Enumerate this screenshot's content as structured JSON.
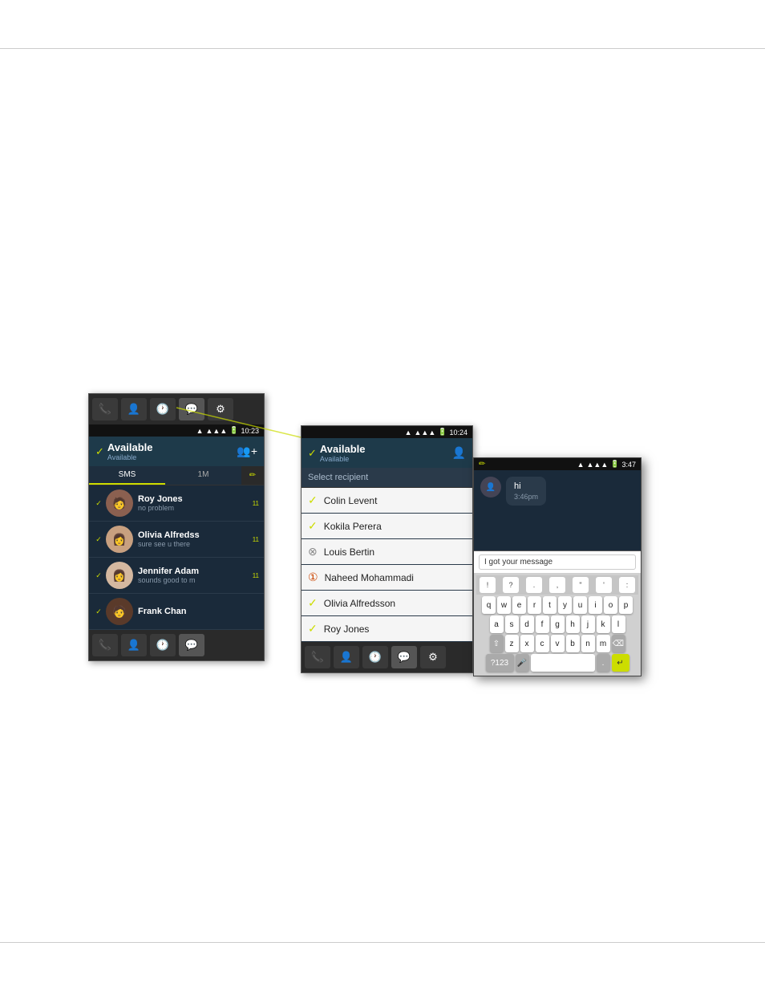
{
  "dividers": {
    "top": true,
    "bottom": true
  },
  "screen1": {
    "toolbar": {
      "icons": [
        "📞",
        "👤",
        "🕐",
        "💬",
        "⚙"
      ]
    },
    "statusBar": {
      "signal": "▲▲▲",
      "battery": "🔋",
      "time": "10:23"
    },
    "header": {
      "status": "Available",
      "substatus": "Available"
    },
    "tabs": [
      {
        "label": "SMS",
        "active": true
      },
      {
        "label": "1M",
        "active": false
      }
    ],
    "contacts": [
      {
        "name": "Roy Jones",
        "message": "no problem",
        "time": "11",
        "statusColor": "available",
        "avatarBg": "#8B6050"
      },
      {
        "name": "Olivia Alfredss",
        "message": "sure see u there",
        "time": "11",
        "statusColor": "available",
        "avatarBg": "#c8a080"
      },
      {
        "name": "Jennifer Adam",
        "message": "sounds good to m",
        "time": "11",
        "statusColor": "available",
        "avatarBg": "#d4b8a0"
      },
      {
        "name": "Frank Chan",
        "message": "",
        "time": "",
        "statusColor": "available",
        "avatarBg": "#5a3a2a"
      }
    ],
    "bottomIcons": [
      "📞",
      "👤",
      "🕐",
      "💬"
    ]
  },
  "screen2": {
    "statusBar": {
      "signal": "▲▲▲",
      "battery": "🔋",
      "time": "10:24"
    },
    "header": {
      "status": "Available",
      "substatus": "Available"
    },
    "selectRecipient": "Select recipient",
    "recipients": [
      {
        "name": "Colin Levent",
        "status": "available"
      },
      {
        "name": "Kokila Perera",
        "status": "available"
      },
      {
        "name": "Louis Bertin",
        "status": "offline"
      },
      {
        "name": "Naheed Mohammadi",
        "status": "busy"
      },
      {
        "name": "Olivia Alfredsson",
        "status": "available"
      },
      {
        "name": "Roy Jones",
        "status": "available"
      }
    ],
    "bottomIcons": [
      "📞",
      "👤",
      "🕐",
      "💬",
      "⚙"
    ]
  },
  "screen3": {
    "statusBar": {
      "signal": "▲▲▲",
      "battery": "🔋",
      "time": "3:47"
    },
    "chat": {
      "receivedMessage": "hi",
      "receivedTime": "3:46pm"
    },
    "inputPlaceholder": "I got your message",
    "keyboard": {
      "specialRow": [
        "!",
        "?",
        ".",
        ",",
        ":"
      ],
      "rows": [
        [
          "q",
          "w",
          "e",
          "r",
          "t",
          "y",
          "u",
          "i",
          "o",
          "p"
        ],
        [
          "a",
          "s",
          "d",
          "f",
          "g",
          "h",
          "j",
          "k",
          "l"
        ],
        [
          "⇧",
          "z",
          "x",
          "c",
          "v",
          "b",
          "n",
          "m",
          "⌫"
        ]
      ],
      "bottomRow": {
        "numbers": "?123",
        "mic": "🎤",
        "space": "",
        "period": ".",
        "enter": "↵"
      }
    }
  }
}
